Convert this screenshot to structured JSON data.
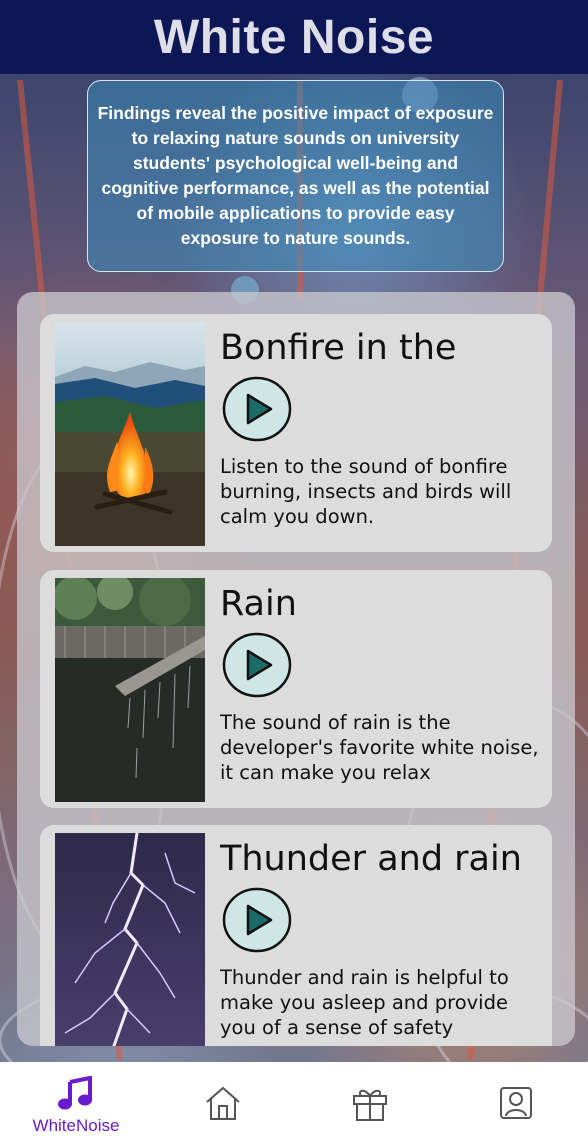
{
  "header": {
    "title": "White Noise"
  },
  "intro": {
    "text": "Findings reveal the positive impact of exposure to relaxing nature sounds on university students' psychological well-being and cognitive performance, as well as the potential of mobile applications to provide easy exposure to nature sounds."
  },
  "sounds": [
    {
      "title": "Bonfire in the",
      "description": "Listen to the sound of bonfire burning, insects and birds will calm you down.",
      "image_icon": "bonfire-image"
    },
    {
      "title": "Rain",
      "description": "The sound of rain is the developer's favorite white noise, it can make you relax",
      "image_icon": "rain-image"
    },
    {
      "title": "Thunder and rain",
      "description": "Thunder and rain is helpful to make you asleep and provide you of a sense of safety",
      "image_icon": "lightning-image"
    }
  ],
  "tabbar": {
    "active": "whitenoise",
    "items": [
      {
        "id": "whitenoise",
        "label": "WhiteNoise",
        "icon": "music-note-icon"
      },
      {
        "id": "home",
        "label": "",
        "icon": "home-icon"
      },
      {
        "id": "gifts",
        "label": "",
        "icon": "gift-icon"
      },
      {
        "id": "profile",
        "label": "",
        "icon": "profile-icon"
      }
    ]
  },
  "colors": {
    "header_bg": "#0d1656",
    "accent": "#6a1bcc",
    "card_bg": "#dcdcdc",
    "play_fill": "#cfe6e6",
    "play_triangle": "#1b6b66"
  }
}
